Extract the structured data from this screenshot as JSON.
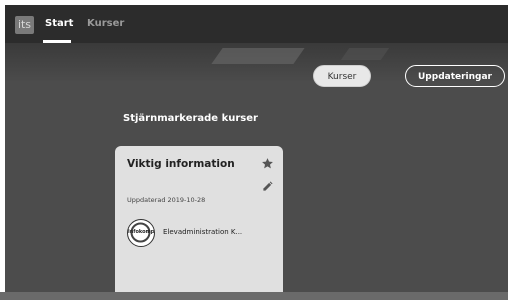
{
  "app": {
    "logo_text": "its"
  },
  "nav": {
    "tabs": [
      {
        "label": "Start",
        "active": true
      },
      {
        "label": "Kurser",
        "active": false
      }
    ]
  },
  "actions": {
    "kurser_label": "Kurser",
    "uppdateringar_label": "Uppdateringar"
  },
  "section": {
    "title": "Stjärnmarkerade kurser"
  },
  "card": {
    "title": "Viktig information",
    "updated": "Uppdaterad 2019-10-28",
    "course_logo_text": "infokomp",
    "course_name": "Elevadministration K..."
  },
  "colors": {
    "topbar": "#2c2c2c",
    "background": "#4c4c4c",
    "card": "#e0e0e0"
  }
}
